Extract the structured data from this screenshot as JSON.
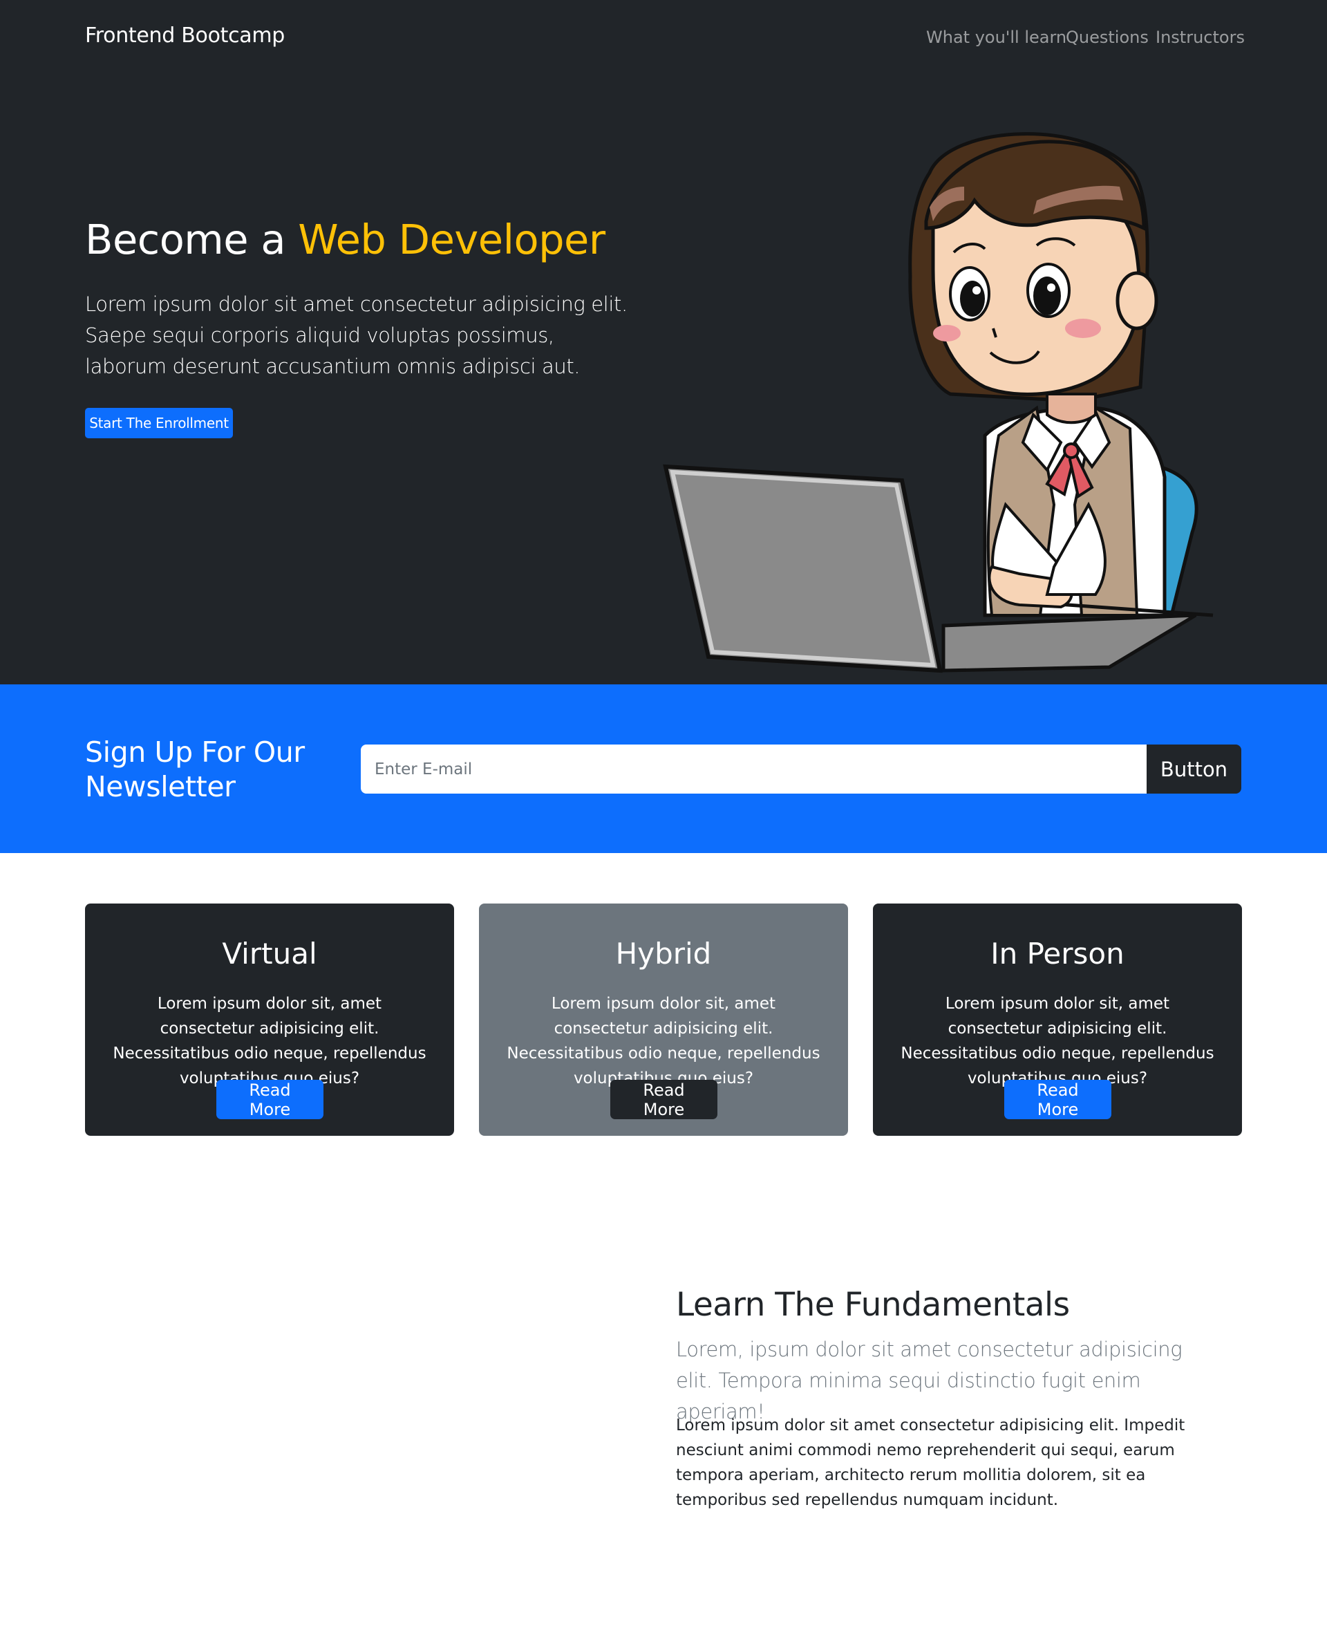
{
  "nav": {
    "brand": "Frontend Bootcamp",
    "links": [
      "What you'll learn",
      "Questions",
      "Instructors"
    ]
  },
  "hero": {
    "title_prefix": "Become a ",
    "title_accent": "Web Developer",
    "text": "Lorem ipsum dolor sit amet consectetur adipisicing elit. Saepe sequi corporis aliquid voluptas possimus, laborum deserunt accusantium omnis adipisci aut.",
    "button": "Start The Enrollment",
    "illustration": "woman-at-laptop-illustration"
  },
  "newsletter": {
    "title": "Sign Up For Our Newsletter",
    "placeholder": "Enter E-mail",
    "button": "Button"
  },
  "cards": [
    {
      "title": "Virtual",
      "text": "Lorem ipsum dolor sit, amet consectetur adipisicing elit. Necessitatibus odio neque, repellendus voluptatibus quo eius?",
      "button": "Read More"
    },
    {
      "title": "Hybrid",
      "text": "Lorem ipsum dolor sit, amet consectetur adipisicing elit. Necessitatibus odio neque, repellendus voluptatibus quo eius?",
      "button": "Read More"
    },
    {
      "title": "In Person",
      "text": "Lorem ipsum dolor sit, amet consectetur adipisicing elit. Necessitatibus odio neque, repellendus voluptatibus quo eius?",
      "button": "Read More"
    }
  ],
  "learn": {
    "title": "Learn The Fundamentals",
    "lead": "Lorem, ipsum dolor sit amet consectetur adipisicing elit. Tempora minima sequi distinctio fugit enim aperiam!",
    "body": "Lorem ipsum dolor sit amet consectetur adipisicing elit. Impedit nesciunt animi commodi nemo reprehenderit qui sequi, earum tempora aperiam, architecto rerum mollitia dolorem, sit ea temporibus sed repellendus numquam incidunt."
  },
  "colors": {
    "dark": "#212529",
    "primary": "#0d6efd",
    "accent": "#ffc107",
    "secondary": "#6c757d"
  }
}
